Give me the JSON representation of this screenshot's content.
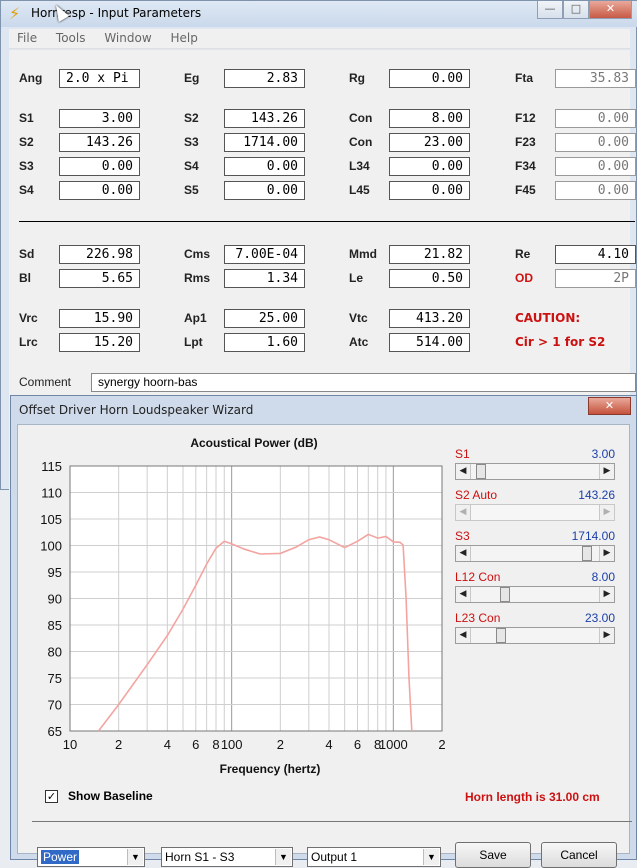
{
  "main_window": {
    "title": "Hornresp - Input Parameters",
    "icon": "lightning-icon",
    "caption": {
      "minimize": "—",
      "maximize": "□",
      "close": "✕"
    }
  },
  "menu": [
    "File",
    "Tools",
    "Window",
    "Help"
  ],
  "params": {
    "ang": {
      "label": "Ang",
      "value": "2.0 x Pi"
    },
    "eg": {
      "label": "Eg",
      "value": "2.83"
    },
    "rg": {
      "label": "Rg",
      "value": "0.00"
    },
    "fta": {
      "label": "Fta",
      "value": "35.83"
    },
    "row1": [
      {
        "label": "S1",
        "value": "3.00"
      },
      {
        "label": "S2",
        "value": "143.26"
      },
      {
        "label": "Con",
        "value": "8.00"
      },
      {
        "label": "F12",
        "value": "0.00"
      }
    ],
    "row2": [
      {
        "label": "S2",
        "value": "143.26"
      },
      {
        "label": "S3",
        "value": "1714.00"
      },
      {
        "label": "Con",
        "value": "23.00"
      },
      {
        "label": "F23",
        "value": "0.00"
      }
    ],
    "row3": [
      {
        "label": "S3",
        "value": "0.00"
      },
      {
        "label": "S4",
        "value": "0.00"
      },
      {
        "label": "L34",
        "value": "0.00"
      },
      {
        "label": "F34",
        "value": "0.00"
      }
    ],
    "row4": [
      {
        "label": "S4",
        "value": "0.00"
      },
      {
        "label": "S5",
        "value": "0.00"
      },
      {
        "label": "L45",
        "value": "0.00"
      },
      {
        "label": "F45",
        "value": "0.00"
      }
    ],
    "row5": [
      {
        "label": "Sd",
        "value": "226.98"
      },
      {
        "label": "Cms",
        "value": "7.00E-04"
      },
      {
        "label": "Mmd",
        "value": "21.82"
      },
      {
        "label": "Re",
        "value": "4.10"
      }
    ],
    "row6": [
      {
        "label": "Bl",
        "value": "5.65"
      },
      {
        "label": "Rms",
        "value": "1.34"
      },
      {
        "label": "Le",
        "value": "0.50"
      },
      {
        "label": "OD",
        "value": "2P"
      }
    ],
    "row7": [
      {
        "label": "Vrc",
        "value": "15.90"
      },
      {
        "label": "Ap1",
        "value": "25.00"
      },
      {
        "label": "Vtc",
        "value": "413.20"
      }
    ],
    "row8": [
      {
        "label": "Lrc",
        "value": "15.20"
      },
      {
        "label": "Lpt",
        "value": "1.60"
      },
      {
        "label": "Atc",
        "value": "514.00"
      }
    ],
    "caution_title": "CAUTION:",
    "caution_text": "Cir > 1 for S2",
    "comment_label": "Comment",
    "comment_value": "synergy hoorn-bas"
  },
  "wizard": {
    "title": "Offset Driver Horn Loudspeaker Wizard",
    "close": "✕",
    "sliders": [
      {
        "label": "S1",
        "value": "3.00",
        "enabled": true,
        "position": 0.03
      },
      {
        "label": "S2 Auto",
        "value": "143.26",
        "enabled": false,
        "position": 0.0
      },
      {
        "label": "S3",
        "value": "1714.00",
        "enabled": true,
        "position": 0.93
      },
      {
        "label": "L12 Con",
        "value": "8.00",
        "enabled": true,
        "position": 0.24
      },
      {
        "label": "L23 Con",
        "value": "23.00",
        "enabled": true,
        "position": 0.2
      }
    ],
    "show_baseline_label": "Show Baseline",
    "show_baseline_checked": "✓",
    "horn_length": "Horn length is 31.00 cm",
    "dropdowns": {
      "mode": "Power",
      "horn": "Horn S1 - S3",
      "output": "Output 1"
    },
    "buttons": {
      "save": "Save",
      "cancel": "Cancel"
    }
  },
  "chart_data": {
    "type": "line",
    "title": "Acoustical Power (dB)",
    "xlabel": "Frequency (hertz)",
    "ylabel": "",
    "xscale": "log",
    "xlim": [
      10,
      2000
    ],
    "ylim": [
      65,
      115
    ],
    "yticks": [
      65,
      70,
      75,
      80,
      85,
      90,
      95,
      100,
      105,
      110,
      115
    ],
    "xtick_labels": [
      "10",
      "2",
      "4",
      "6",
      "8",
      "100",
      "2",
      "4",
      "6",
      "8",
      "1000",
      "2"
    ],
    "grid": true,
    "series": [
      {
        "color": "#f4a4a0",
        "x": [
          15,
          20,
          30,
          40,
          50,
          60,
          70,
          80,
          90,
          100,
          120,
          150,
          200,
          250,
          300,
          350,
          400,
          500,
          600,
          700,
          800,
          900,
          1000,
          1100,
          1150,
          1200,
          1250,
          1300
        ],
        "y": [
          65,
          70,
          77.5,
          83,
          88,
          92.5,
          96.5,
          99.5,
          100.8,
          100.3,
          99.3,
          98.4,
          98.5,
          99.7,
          101.1,
          101.6,
          101.1,
          99.6,
          100.8,
          102.1,
          101.4,
          101.7,
          100.7,
          100.6,
          100.1,
          90,
          75,
          65
        ]
      }
    ]
  }
}
